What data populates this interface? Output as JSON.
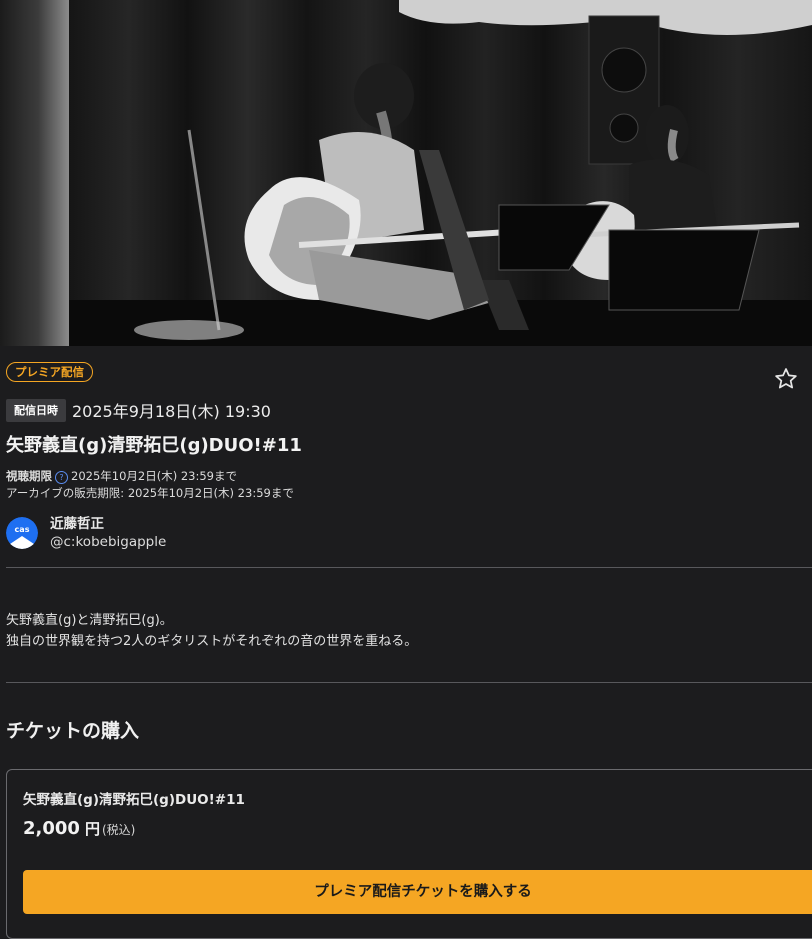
{
  "event": {
    "premier_badge": "プレミア配信",
    "date_label": "配信日時",
    "date_value": "2025年9月18日(木) 19:30",
    "title": "矢野義直(g)清野拓巳(g)DUO!#11",
    "viewing_period_label": "視聴期限",
    "viewing_period_value": "2025年10月2日(木) 23:59まで",
    "archive_line": "アーカイブの販売期限: 2025年10月2日(木) 23:59まで"
  },
  "channel": {
    "name": "近藤哲正",
    "id": "@c:kobebigapple",
    "avatar_text": "cas"
  },
  "description": {
    "line1": "矢野義直(g)と清野拓巳(g)。",
    "line2": "独自の世界観を持つ2人のギタリストがそれぞれの音の世界を重ねる。"
  },
  "tickets": {
    "section_title": "チケットの購入",
    "item_name": "矢野義直(g)清野拓巳(g)DUO!#11",
    "price": "2,000",
    "currency": "円",
    "tax_note": "(税込)",
    "buy_label": "プレミア配信チケットを購入する"
  },
  "colors": {
    "background": "#1c1c1e",
    "accent": "#f5a623",
    "avatar_blue": "#1e6ff1"
  },
  "icons": {
    "favorite": "star-outline-icon",
    "help": "question-circle-icon"
  }
}
